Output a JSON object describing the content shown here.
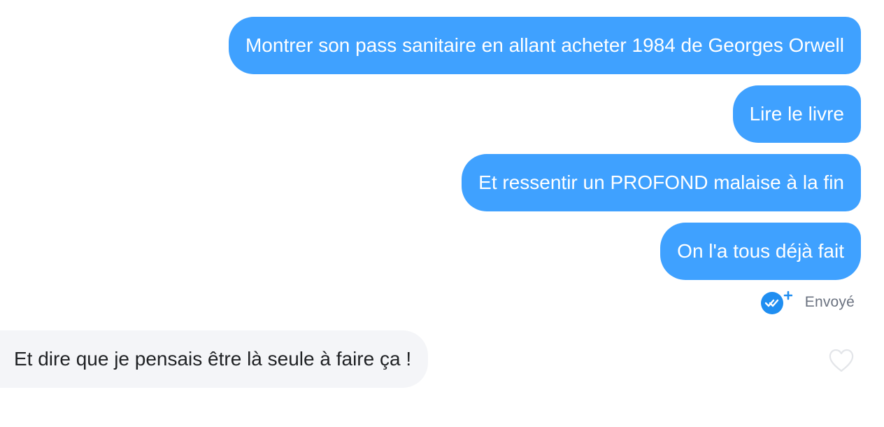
{
  "conversation": {
    "sent_messages": [
      "Montrer son pass sanitaire en allant acheter 1984 de Georges Orwell",
      "Lire le livre",
      "Et ressentir un PROFOND malaise à la fin",
      "On l'a tous déjà fait"
    ],
    "status": {
      "icon": "double-check-plus-icon",
      "label": "Envoyé"
    },
    "received_messages": [
      "Et dire que je pensais être là seule à faire ça !"
    ],
    "like_icon": "heart-outline-icon"
  },
  "colors": {
    "sent_bubble": "#3fa1ff",
    "received_bubble": "#f4f5f8",
    "status_text": "#6b7280",
    "read_badge": "#1f8ef1"
  }
}
